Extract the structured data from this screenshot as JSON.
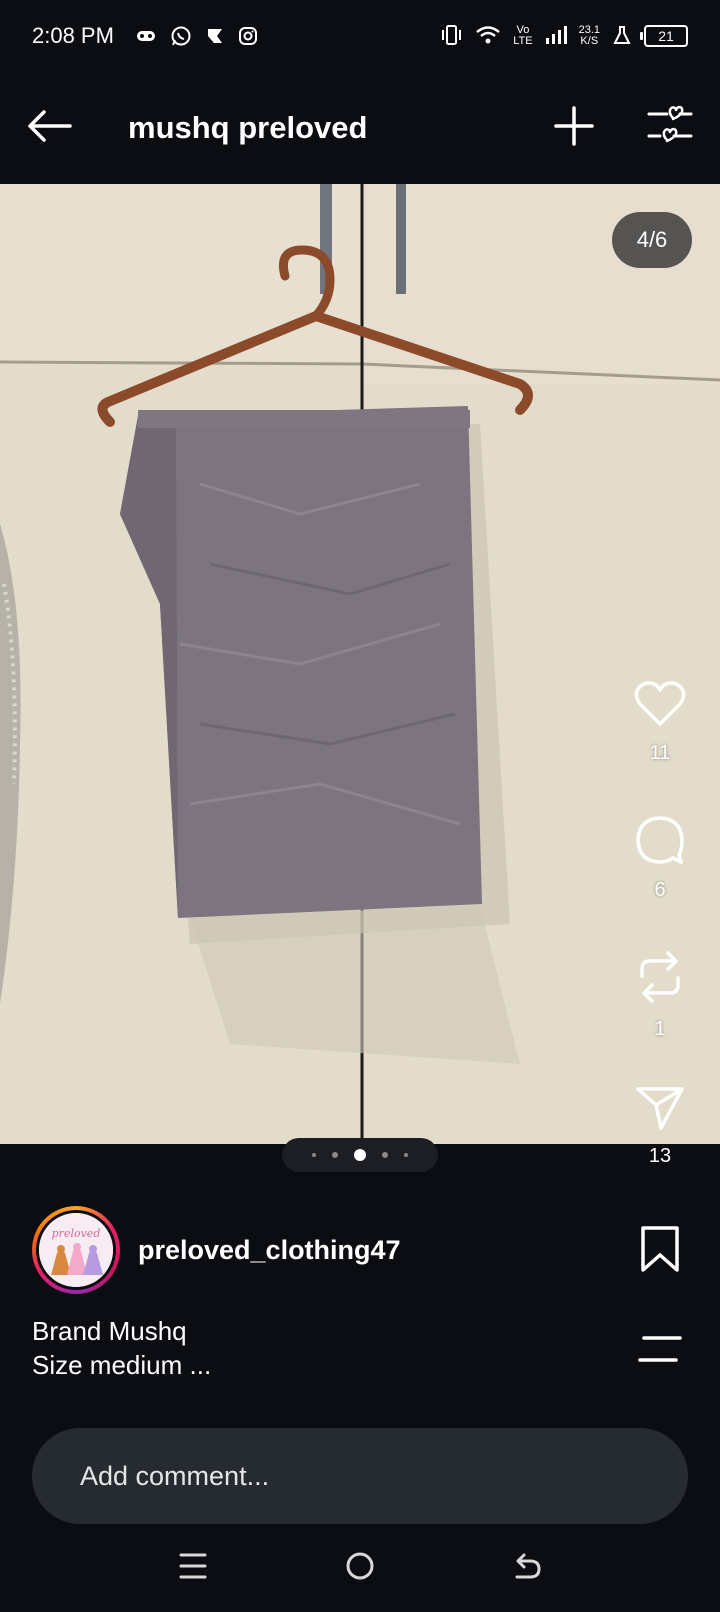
{
  "status_bar": {
    "time": "2:08 PM",
    "vo_top": "Vo",
    "vo_bottom": "LTE",
    "speed_value": "23.1",
    "speed_unit": "K/S",
    "battery": "21"
  },
  "header": {
    "title": "mushq preloved"
  },
  "post": {
    "page_counter": "4/6",
    "likes": "11",
    "comments": "6",
    "reposts": "1",
    "shares": "13",
    "author": "preloved_clothing47",
    "avatar_text": "preloved",
    "caption_line1": "Brand Mushq",
    "caption_line2": "Size medium ..."
  },
  "comment": {
    "placeholder": "Add comment..."
  }
}
